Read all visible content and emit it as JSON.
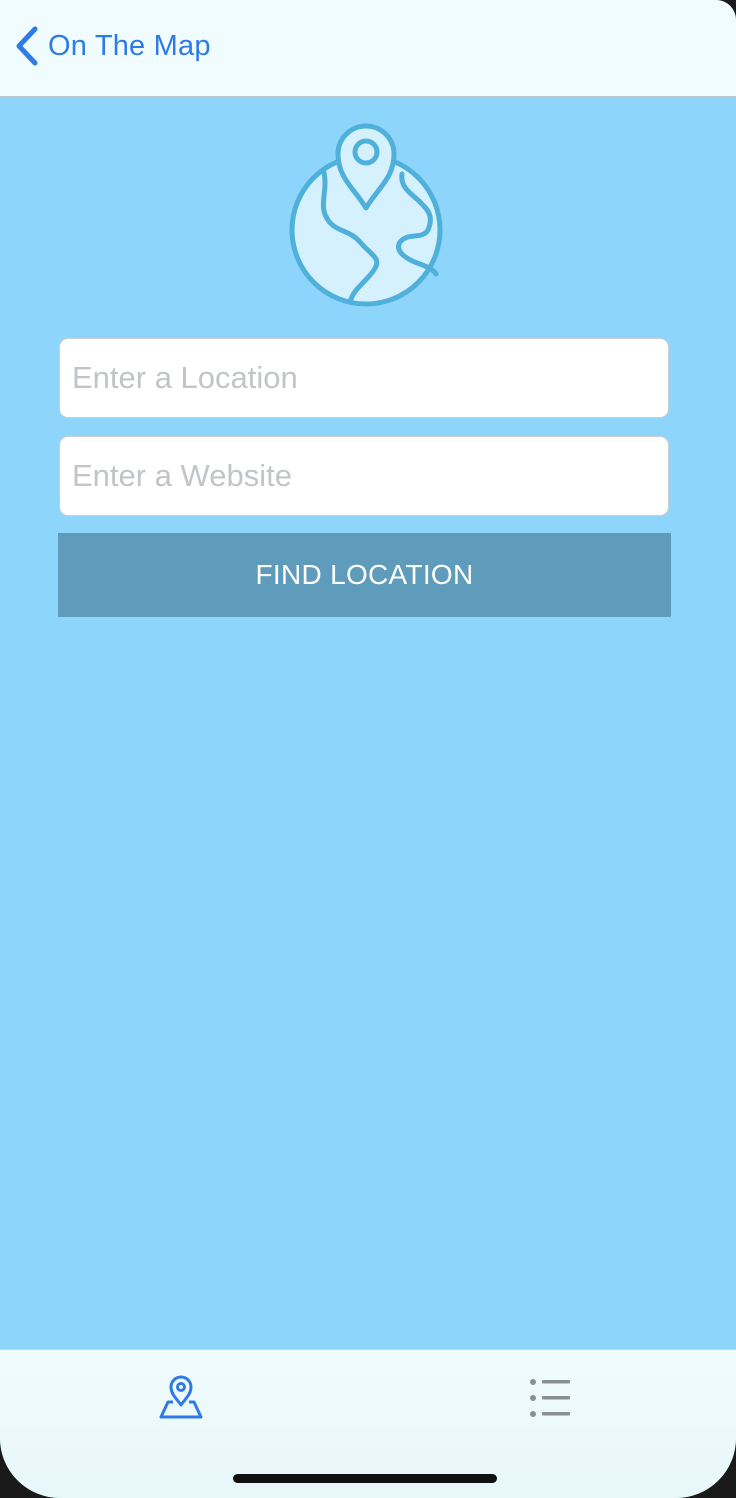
{
  "nav": {
    "back_label": "On The Map",
    "back_icon": "chevron-left-icon"
  },
  "form": {
    "location_placeholder": "Enter a Location",
    "location_value": "",
    "website_placeholder": "Enter a Website",
    "website_value": "",
    "find_button_label": "FIND LOCATION"
  },
  "header_image": {
    "icon": "globe-pin-icon"
  },
  "tab_bar": {
    "tabs": [
      {
        "name": "map",
        "icon": "map-pin-icon",
        "selected": true
      },
      {
        "name": "list",
        "icon": "list-icon",
        "selected": false
      }
    ]
  },
  "colors": {
    "background": "#8dd5fb",
    "nav_background": "#f0fcfd",
    "accent": "#2f7be6",
    "button": "#5f9cbb",
    "button_text": "#ffffff",
    "globe_stroke": "#4fb0dc",
    "tab_inactive": "#8a8f94"
  }
}
